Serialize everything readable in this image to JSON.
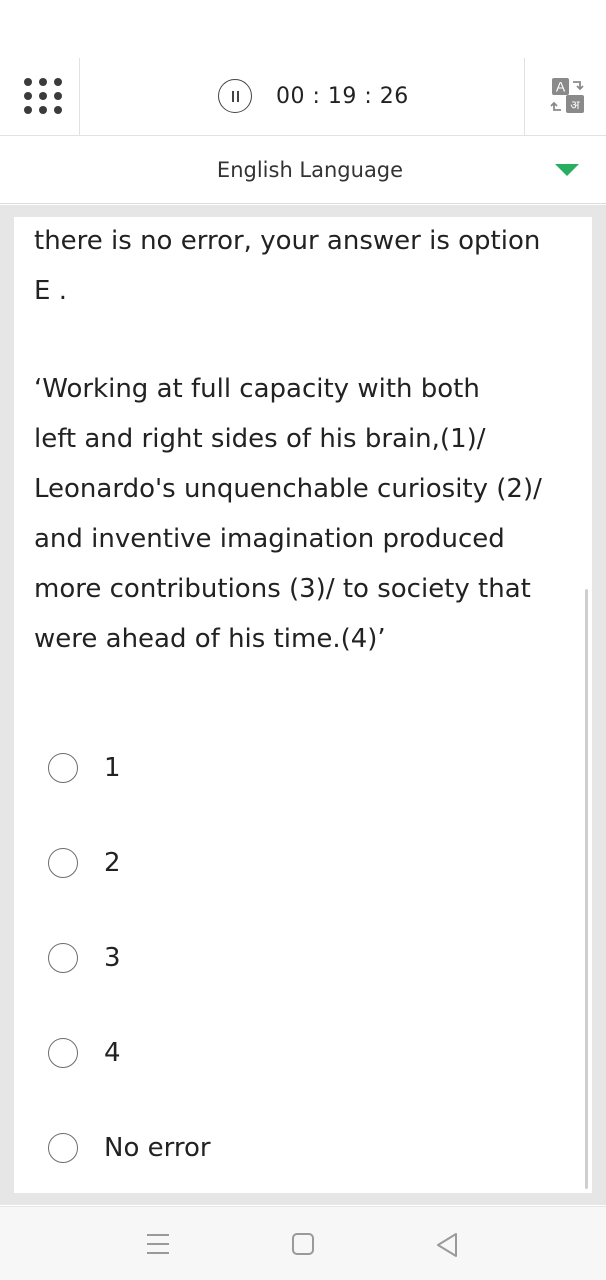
{
  "header": {
    "timer": "00 : 19 : 26",
    "grid_icon": "grid-dots-icon",
    "pause_icon": "pause-icon",
    "language_icon": "translate-icon",
    "language_glyphs": {
      "latin": "A",
      "devanagari": "अ"
    }
  },
  "section": {
    "title": "English Language",
    "caret_color": "#27ae60"
  },
  "question": {
    "intro_line1": "there is no error, your answer is option",
    "intro_line2": "E .",
    "sentence_lines": [
      "‘Working at full capacity with both",
      "left and right sides of his brain,(1)/",
      "Leonardo's unquenchable curiosity (2)/",
      "and inventive imagination produced",
      "more contributions (3)/ to society that",
      "were ahead of his time.(4)’"
    ]
  },
  "options": [
    {
      "label": "1"
    },
    {
      "label": "2"
    },
    {
      "label": "3"
    },
    {
      "label": "4"
    },
    {
      "label": "No error"
    }
  ],
  "navbar": {
    "menu_icon": "recent-apps-icon",
    "home_icon": "home-icon",
    "back_icon": "back-icon"
  }
}
